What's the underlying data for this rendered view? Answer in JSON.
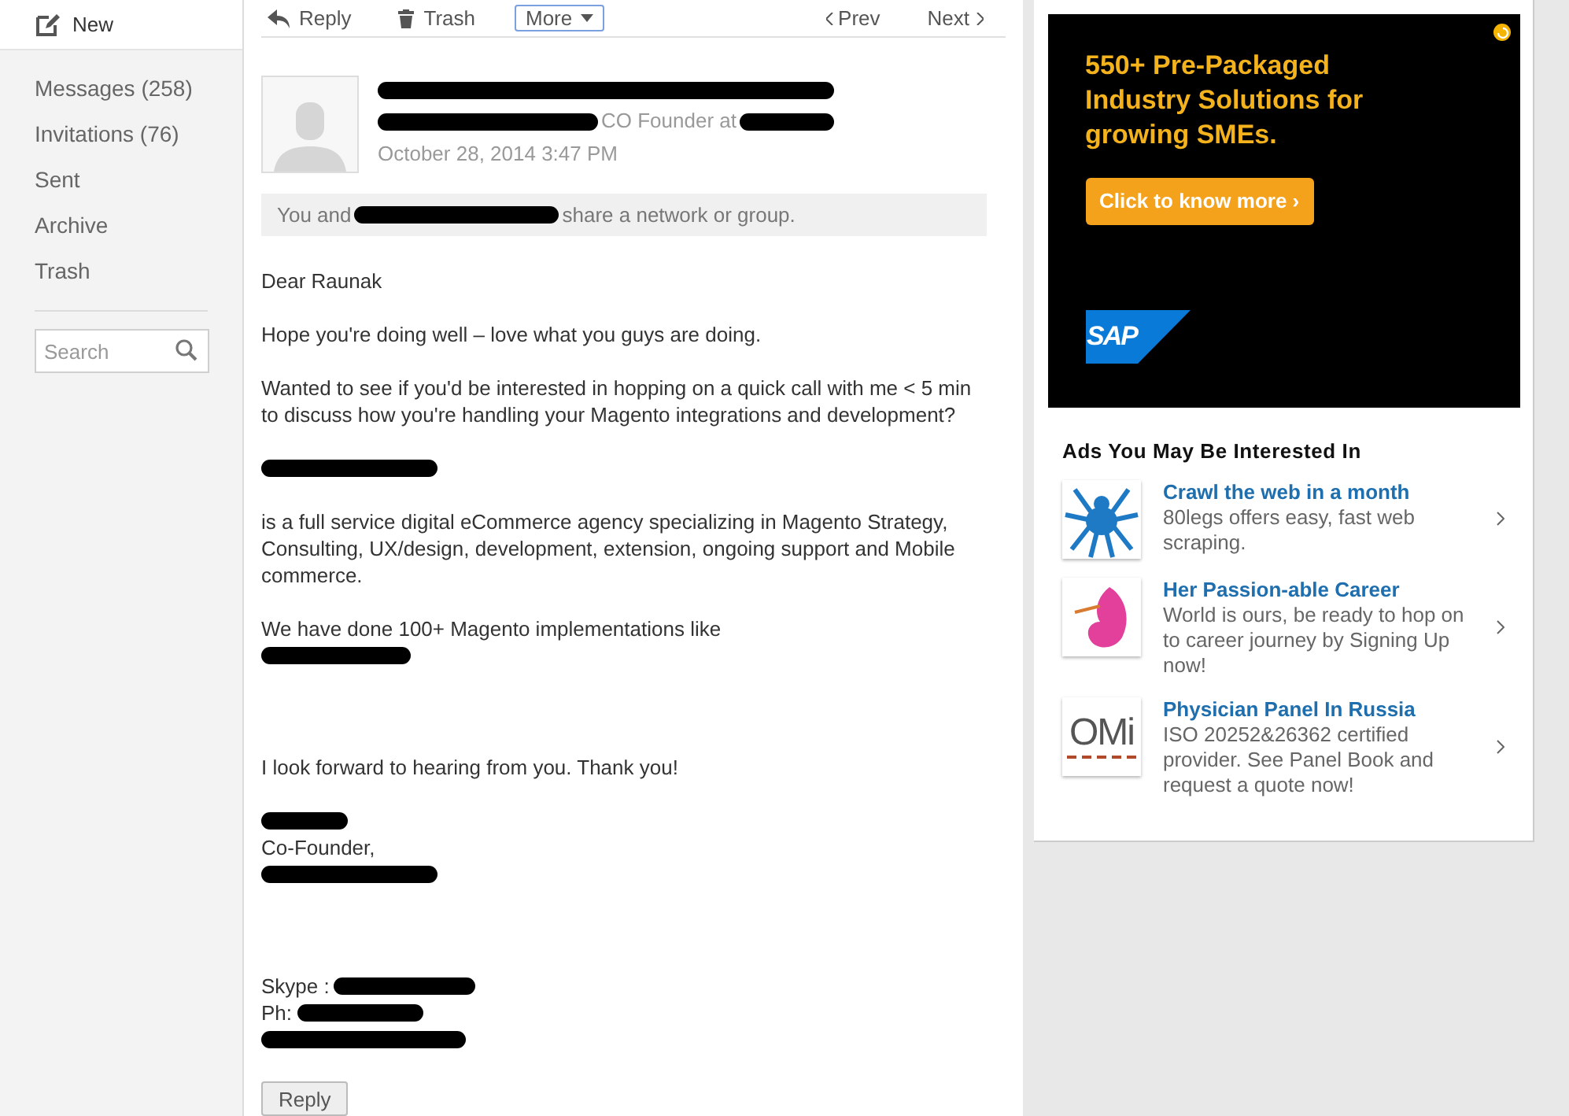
{
  "sidebar": {
    "new_label": "New",
    "items": [
      {
        "label": "Messages (258)",
        "selected": false
      },
      {
        "label": "Invitations (76)",
        "selected": false
      },
      {
        "label": "Sent",
        "selected": false
      },
      {
        "label": "Archive",
        "selected": false
      },
      {
        "label": "Trash",
        "selected": false
      }
    ],
    "search": {
      "placeholder": "Search"
    }
  },
  "toolbar": {
    "reply": "Reply",
    "trash": "Trash",
    "more": "More",
    "prev": "Prev",
    "next": "Next"
  },
  "message": {
    "sender_line": [
      {
        "kind": "redaction"
      }
    ],
    "headline": [
      {
        "kind": "redaction"
      },
      {
        "kind": "text",
        "text": "CO Founder at"
      },
      {
        "kind": "redaction"
      }
    ],
    "date": "October 28, 2014 3:47 PM",
    "shared": [
      {
        "kind": "text",
        "text": "You and"
      },
      {
        "kind": "redaction"
      },
      {
        "kind": "text",
        "text": "share a network or group."
      }
    ],
    "body": [
      {
        "parts": [
          {
            "kind": "text",
            "text": "Dear Raunak"
          }
        ]
      },
      {
        "parts": [
          {
            "kind": "text",
            "text": "Hope you're doing well – love what you guys are doing."
          }
        ]
      },
      {
        "parts": [
          {
            "kind": "text",
            "text": "Wanted to see if you'd be interested in hopping on a quick call with me < 5 min to discuss how you're handling your Magento integrations and development?"
          }
        ]
      },
      {
        "parts": [
          {
            "kind": "redaction"
          }
        ]
      },
      {
        "parts": [
          {
            "kind": "text",
            "text": "is a full service digital eCommerce agency specializing in Magento Strategy, Consulting, UX/design, development, extension, ongoing support and Mobile commerce."
          }
        ]
      },
      {
        "parts": [
          {
            "kind": "text",
            "text": "We have done 100+ Magento implementations like"
          }
        ]
      },
      {
        "parts": [
          {
            "kind": "redaction"
          }
        ]
      },
      {
        "parts": [
          {
            "kind": "text",
            "text": "I look forward to hearing from you. Thank you!"
          }
        ]
      },
      {
        "parts": [
          {
            "kind": "redaction"
          }
        ]
      },
      {
        "parts": [
          {
            "kind": "text",
            "text": "Co-Founder,"
          }
        ]
      },
      {
        "parts": [
          {
            "kind": "redaction"
          }
        ]
      },
      {
        "parts": [
          {
            "kind": "text",
            "text": "Skype :"
          },
          {
            "kind": "redaction"
          }
        ]
      },
      {
        "parts": [
          {
            "kind": "text",
            "text": "Ph:"
          },
          {
            "kind": "redaction"
          }
        ]
      },
      {
        "parts": [
          {
            "kind": "redaction"
          }
        ]
      }
    ],
    "reply_button": "Reply"
  },
  "ad": {
    "headline": "550+ Pre-Packaged Industry Solutions for growing SMEs.",
    "cta": "Click to know more ›",
    "brand": "SAP"
  },
  "ads_section": {
    "title": "Ads You May Be Interested In",
    "items": [
      {
        "kind": "spider",
        "title": "Crawl the web in a month",
        "text": "80legs offers easy, fast web scraping."
      },
      {
        "kind": "figure",
        "title": "Her Passion-able Career",
        "text": "World is ours, be ready to hop on to career journey by Signing Up now!"
      },
      {
        "kind": "omi",
        "title": "Physician Panel In Russia",
        "text": "ISO 20252&26362 certified provider. See Panel Book and request a quote now!",
        "logo": "OMi"
      }
    ]
  }
}
